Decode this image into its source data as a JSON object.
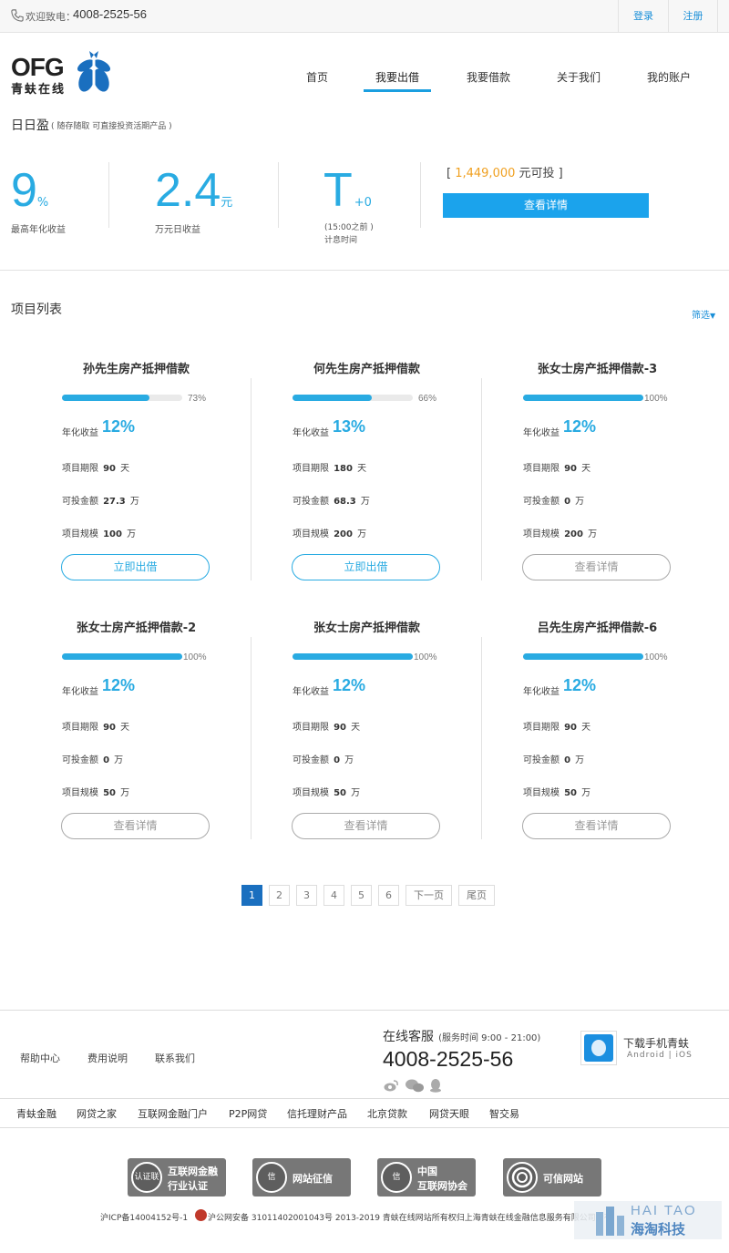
{
  "topbar": {
    "welcome": "欢迎致电：",
    "hotline": "4008-2525-56",
    "login": "登录",
    "register": "注册"
  },
  "logo": {
    "mark": "OFG",
    "cn": "青蚨在线"
  },
  "nav": {
    "items": [
      "首页",
      "我要出借",
      "我要借款",
      "关于我们",
      "我的账户"
    ],
    "active": "我要出借"
  },
  "product": {
    "name": "日日盈",
    "desc": "( 随存随取 可直接投资活期产品 )",
    "rate_value": "9",
    "rate_unit": "%",
    "rate_label": "最高年化收益",
    "daily_value": "2.4",
    "daily_unit": "元",
    "daily_label": "万元日收益",
    "t_value": "T",
    "t_plus": "+0",
    "t_note": "(15:00之前 )",
    "t_label": "计息时间",
    "avail_prefix": "[ ",
    "avail_amount": "1,449,000",
    "avail_suffix": " 元可投 ]",
    "detail_button": "查看详情"
  },
  "projects": {
    "title": "项目列表",
    "filter": "筛选",
    "labels": {
      "rate": "年化收益",
      "term": "项目期限",
      "available": "可投金额",
      "scale": "项目规模"
    },
    "items": [
      {
        "name": "孙先生房产抵押借款",
        "progress": 73,
        "pct": "73%",
        "rate": "12%",
        "term": "90",
        "term_unit": "天",
        "available": "27.3",
        "available_unit": "万",
        "scale": "100",
        "scale_unit": "万",
        "button": "立即出借",
        "active": true
      },
      {
        "name": "何先生房产抵押借款",
        "progress": 66,
        "pct": "66%",
        "rate": "13%",
        "term": "180",
        "term_unit": "天",
        "available": "68.3",
        "available_unit": "万",
        "scale": "200",
        "scale_unit": "万",
        "button": "立即出借",
        "active": true
      },
      {
        "name": "张女士房产抵押借款-3",
        "progress": 100,
        "pct": "100%",
        "rate": "12%",
        "term": "90",
        "term_unit": "天",
        "available": "0",
        "available_unit": "万",
        "scale": "200",
        "scale_unit": "万",
        "button": "查看详情",
        "active": false
      },
      {
        "name": "张女士房产抵押借款-2",
        "progress": 100,
        "pct": "100%",
        "rate": "12%",
        "term": "90",
        "term_unit": "天",
        "available": "0",
        "available_unit": "万",
        "scale": "50",
        "scale_unit": "万",
        "button": "查看详情",
        "active": false
      },
      {
        "name": "张女士房产抵押借款",
        "progress": 100,
        "pct": "100%",
        "rate": "12%",
        "term": "90",
        "term_unit": "天",
        "available": "0",
        "available_unit": "万",
        "scale": "50",
        "scale_unit": "万",
        "button": "查看详情",
        "active": false
      },
      {
        "name": "吕先生房产抵押借款-6",
        "progress": 100,
        "pct": "100%",
        "rate": "12%",
        "term": "90",
        "term_unit": "天",
        "available": "0",
        "available_unit": "万",
        "scale": "50",
        "scale_unit": "万",
        "button": "查看详情",
        "active": false
      }
    ]
  },
  "pagination": {
    "pages": [
      "1",
      "2",
      "3",
      "4",
      "5",
      "6"
    ],
    "current": "1",
    "next": "下一页",
    "last": "尾页"
  },
  "footer": {
    "links": [
      "帮助中心",
      "费用说明",
      "联系我们"
    ],
    "service_title": "在线客服",
    "service_hours": "(服务时间 9:00 - 21:00)",
    "service_phone": "4008-2525-56",
    "app_title": "下载手机青蚨",
    "app_platforms": "Android | iOS",
    "partners": [
      "青蚨金融",
      "网贷之家",
      "互联网金融门户",
      "P2P网贷",
      "信托理财产品",
      "北京贷款",
      "网贷天眼",
      "智交易"
    ],
    "badges": [
      {
        "left": "认证联盟",
        "right_line1": "互联网金融",
        "right_line2": "行业认证"
      },
      {
        "left": "信",
        "right_line1": "网站征信",
        "right_line2": ""
      },
      {
        "left": "信",
        "right_line1": "中国",
        "right_line2": "互联网协会"
      },
      {
        "left": "",
        "right_line1": "可信网站",
        "right_line2": ""
      }
    ],
    "icp": "沪ICP备14004152号-1",
    "police": "沪公网安备 31011402001043号 2013-2019 青蚨在线网站所有权归上海青蚨在线金融信息服务有限公司所有",
    "watermark_en": "HAI TAO",
    "watermark_cn": "海淘科技"
  },
  "colors": {
    "accent": "#29abe2",
    "button_blue": "#1ba3ec",
    "amount_orange": "#f0a020",
    "page_active": "#1a6fbf"
  }
}
